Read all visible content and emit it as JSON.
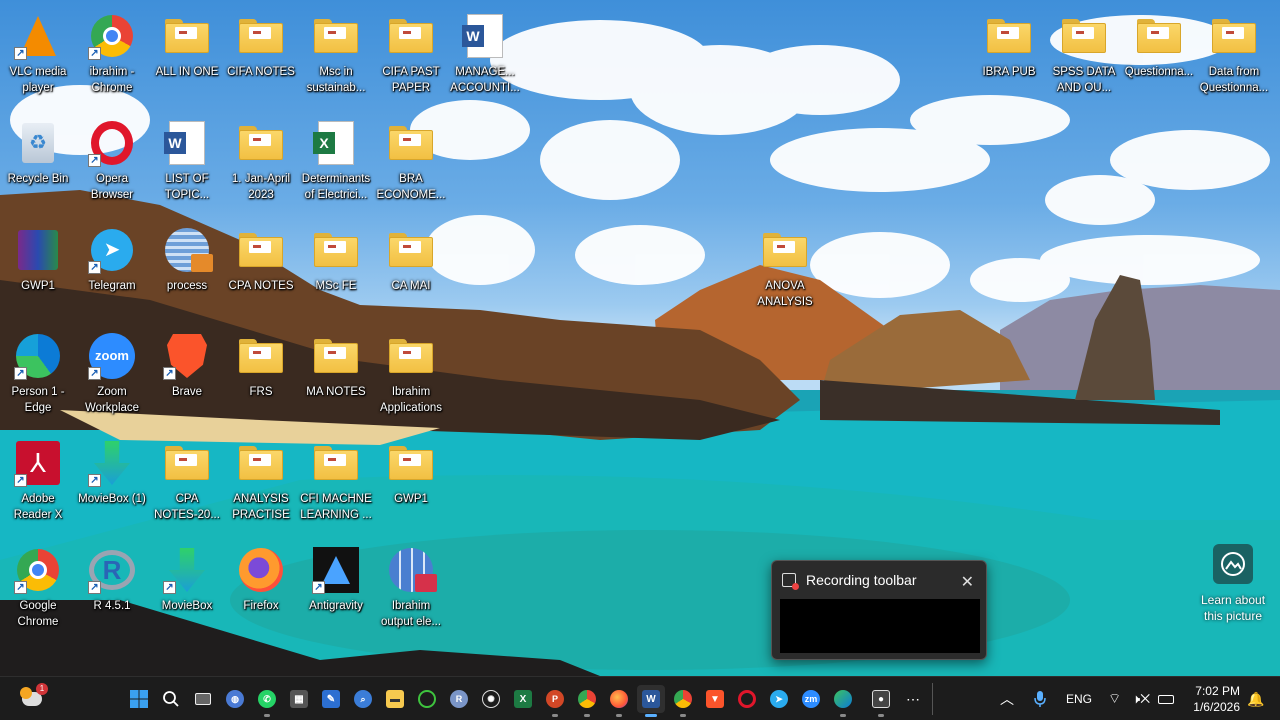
{
  "desktop": {
    "icons": [
      {
        "label": "VLC media\nplayer",
        "kind": "vlc"
      },
      {
        "label": "ibrahim -\nChrome",
        "kind": "chrome"
      },
      {
        "label": "ALL IN ONE",
        "kind": "folder"
      },
      {
        "label": "CIFA NOTES",
        "kind": "folder"
      },
      {
        "label": "Msc in\nsustainab...",
        "kind": "folder"
      },
      {
        "label": "CIFA PAST\nPAPER",
        "kind": "folder"
      },
      {
        "label": "MANAGE...\nACCOUNTI...",
        "kind": "word"
      },
      {
        "label": "Recycle Bin",
        "kind": "recycle"
      },
      {
        "label": "Opera\nBrowser",
        "kind": "opera"
      },
      {
        "label": "LIST OF\nTOPIC...",
        "kind": "word"
      },
      {
        "label": "1. Jan-April\n2023",
        "kind": "folder"
      },
      {
        "label": "Determinants\nof Electrici...",
        "kind": "excel"
      },
      {
        "label": "BRA\nECONOME...",
        "kind": "folder"
      },
      {
        "label": "GWP1",
        "kind": "winrar"
      },
      {
        "label": "Telegram",
        "kind": "telegram"
      },
      {
        "label": "process",
        "kind": "process"
      },
      {
        "label": "CPA NOTES",
        "kind": "folder"
      },
      {
        "label": "MSc FE",
        "kind": "folder"
      },
      {
        "label": "CA MAI",
        "kind": "folder"
      },
      {
        "label": "Person 1 -\nEdge",
        "kind": "edge"
      },
      {
        "label": "Zoom\nWorkplace",
        "kind": "zoom"
      },
      {
        "label": "Brave",
        "kind": "brave"
      },
      {
        "label": "FRS",
        "kind": "folder"
      },
      {
        "label": "MA NOTES",
        "kind": "folder"
      },
      {
        "label": "Ibrahim\nApplications",
        "kind": "folder"
      },
      {
        "label": "Adobe\nReader X",
        "kind": "adobe"
      },
      {
        "label": "MovieBox (1)",
        "kind": "moviebox"
      },
      {
        "label": "CPA\nNOTES-20...",
        "kind": "folder"
      },
      {
        "label": "ANALYSIS\nPRACTISE",
        "kind": "folder"
      },
      {
        "label": "CFI MACHNE\nLEARNING ...",
        "kind": "folder"
      },
      {
        "label": "GWP1",
        "kind": "folder"
      },
      {
        "label": "Google\nChrome",
        "kind": "chrome"
      },
      {
        "label": "R 4.5.1",
        "kind": "r"
      },
      {
        "label": "MovieBox",
        "kind": "moviebox"
      },
      {
        "label": "Firefox",
        "kind": "firefox"
      },
      {
        "label": "Antigravity",
        "kind": "antigravity"
      },
      {
        "label": "Ibrahim\noutput ele...",
        "kind": "calc"
      },
      {
        "label": "ANOVA\nANALYSIS",
        "kind": "folder"
      },
      {
        "label": "IBRA PUB",
        "kind": "folder"
      },
      {
        "label": "SPSS DATA\nAND OU...",
        "kind": "folder"
      },
      {
        "label": "Questionna...",
        "kind": "folder"
      },
      {
        "label": "Data from\nQuestionna...",
        "kind": "folder"
      }
    ]
  },
  "recording_popup": {
    "title": "Recording toolbar",
    "close": "✕"
  },
  "learn": {
    "label": "Learn about\nthis picture"
  },
  "taskbar": {
    "weather_badge": "1",
    "language": "ENG",
    "time": "7:02 PM",
    "date": "1/6/2026"
  },
  "colors": {
    "taskbar": "#1c1c1c",
    "folder": "#f6c94f",
    "accent": "#5ab0ff"
  }
}
